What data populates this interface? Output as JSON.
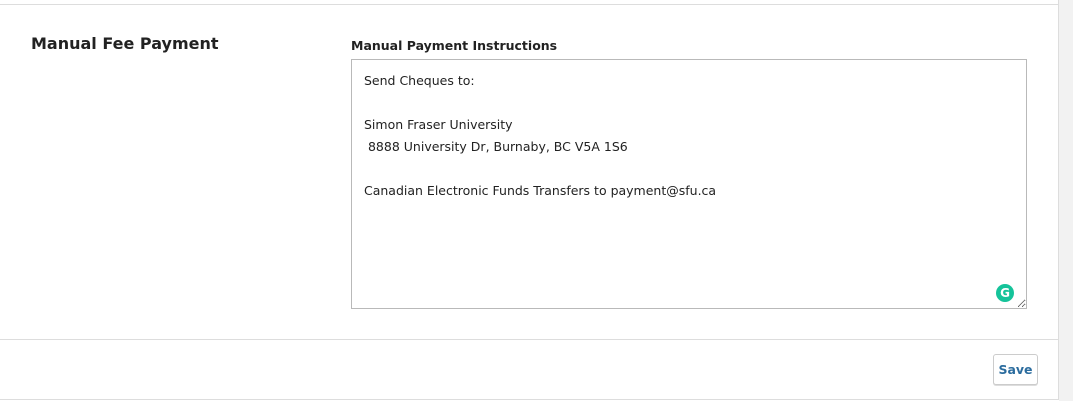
{
  "section": {
    "title": "Manual Fee Payment"
  },
  "field": {
    "label": "Manual Payment Instructions",
    "value": "Send Cheques to:\n\nSimon Fraser University\n 8888 University Dr, Burnaby, BC V5A 1S6\n\nCanadian Electronic Funds Transfers to payment@sfu.ca"
  },
  "grammarly": {
    "icon": "grammarly-icon",
    "glyph": "G",
    "color": "#15c39a"
  },
  "footer": {
    "save_label": "Save"
  },
  "colors": {
    "accent": "#2b6c9e",
    "border": "#dddddd"
  }
}
